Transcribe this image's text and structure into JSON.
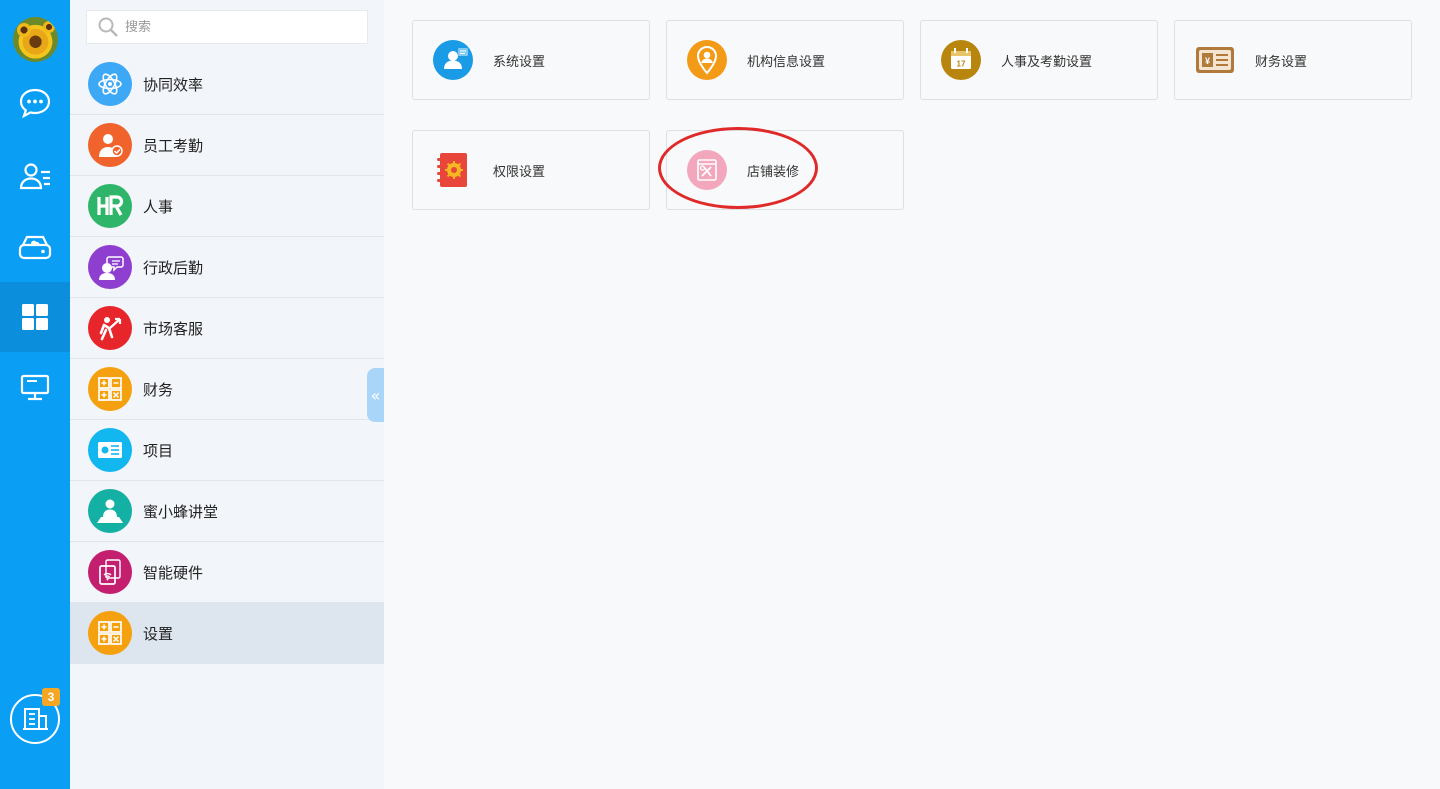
{
  "rail": {
    "badge_count": "3",
    "items": [
      {
        "name": "chat",
        "icon": "chat-bubble-icon"
      },
      {
        "name": "contacts",
        "icon": "contacts-icon"
      },
      {
        "name": "cloud-drive",
        "icon": "cloud-drive-icon"
      },
      {
        "name": "apps",
        "icon": "apps-grid-icon",
        "active": true
      },
      {
        "name": "desktop",
        "icon": "monitor-icon"
      }
    ],
    "accent": "#0a9ff5"
  },
  "sidebar": {
    "search_placeholder": "搜索",
    "items": [
      {
        "label": "协同效率",
        "color": "#3da8f5",
        "icon": "atom-icon"
      },
      {
        "label": "员工考勤",
        "color": "#f0632c",
        "icon": "employee-check-icon"
      },
      {
        "label": "人事",
        "color": "#2fb56a",
        "icon": "hr-icon"
      },
      {
        "label": "行政后勤",
        "color": "#8e3fd0",
        "icon": "admin-service-icon"
      },
      {
        "label": "市场客服",
        "color": "#e6262b",
        "icon": "market-growth-icon"
      },
      {
        "label": "财务",
        "color": "#f5a00f",
        "icon": "calculator-icon"
      },
      {
        "label": "项目",
        "color": "#12b7f0",
        "icon": "project-card-icon"
      },
      {
        "label": "蜜小蜂讲堂",
        "color": "#15b0a4",
        "icon": "lecture-icon"
      },
      {
        "label": "智能硬件",
        "color": "#c31f6e",
        "icon": "smart-device-icon"
      },
      {
        "label": "设置",
        "color": "#f5a00f",
        "icon": "calculator-icon",
        "active": true
      }
    ]
  },
  "cards": [
    {
      "label": "系统设置",
      "color": "#1a9be6",
      "icon": "user-settings-icon"
    },
    {
      "label": "机构信息设置",
      "color": "#f39a17",
      "icon": "location-pin-icon"
    },
    {
      "label": "人事及考勤设置",
      "color": "#b8860f",
      "icon": "calendar-icon"
    },
    {
      "label": "财务设置",
      "color": "#b07a3c",
      "icon": "finance-card-icon"
    },
    {
      "label": "权限设置",
      "color": "#e8463a",
      "icon": "permission-book-icon"
    },
    {
      "label": "店铺装修",
      "color": "#f3a7bd",
      "icon": "shop-decoration-icon"
    }
  ]
}
